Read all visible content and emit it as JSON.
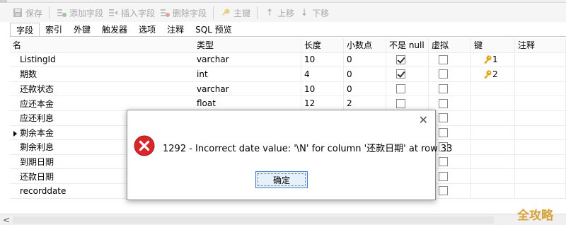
{
  "toolbar": {
    "save": "保存",
    "add_field": "添加字段",
    "insert_field": "插入字段",
    "delete_field": "删除字段",
    "primary_key": "主键",
    "move_up": "上移",
    "move_down": "下移"
  },
  "tabs": [
    "字段",
    "索引",
    "外键",
    "触发器",
    "选项",
    "注释",
    "SQL 预览"
  ],
  "grid": {
    "headers": [
      "名",
      "类型",
      "长度",
      "小数点",
      "不是 null",
      "虚拟",
      "键",
      "注释"
    ],
    "rows": [
      {
        "name": "ListingId",
        "type": "varchar",
        "length": "10",
        "decimals": "0",
        "not_null": true,
        "virtual": false,
        "key": "1"
      },
      {
        "name": "期数",
        "type": "int",
        "length": "4",
        "decimals": "0",
        "not_null": true,
        "virtual": false,
        "key": "2"
      },
      {
        "name": "还款状态",
        "type": "varchar",
        "length": "10",
        "decimals": "0",
        "not_null": false,
        "virtual": false,
        "key": ""
      },
      {
        "name": "应还本金",
        "type": "float",
        "length": "12",
        "decimals": "2",
        "not_null": false,
        "virtual": false,
        "key": ""
      },
      {
        "name": "应还利息",
        "type": "",
        "length": "",
        "decimals": "",
        "not_null": false,
        "virtual": false,
        "key": ""
      },
      {
        "name": "剩余本金",
        "type": "",
        "length": "",
        "decimals": "",
        "not_null": false,
        "virtual": false,
        "key": ""
      },
      {
        "name": "剩余利息",
        "type": "",
        "length": "",
        "decimals": "",
        "not_null": false,
        "virtual": false,
        "key": ""
      },
      {
        "name": "到期日期",
        "type": "",
        "length": "",
        "decimals": "",
        "not_null": false,
        "virtual": false,
        "key": ""
      },
      {
        "name": "还款日期",
        "type": "",
        "length": "",
        "decimals": "",
        "not_null": false,
        "virtual": false,
        "key": ""
      },
      {
        "name": "recorddate",
        "type": "",
        "length": "",
        "decimals": "",
        "not_null": false,
        "virtual": false,
        "key": ""
      }
    ]
  },
  "dialog": {
    "message": "1292 - Incorrect date value: '\\N' for column '还款日期' at row 33",
    "ok_label": "确定",
    "close_glyph": "✕"
  },
  "scrollbar": {
    "left_arrow": "<"
  },
  "watermark": "全攻略",
  "colors": {
    "error_red": "#d9262b",
    "key_gold": "#e3a21a",
    "button_blue": "#3c7fd1"
  }
}
